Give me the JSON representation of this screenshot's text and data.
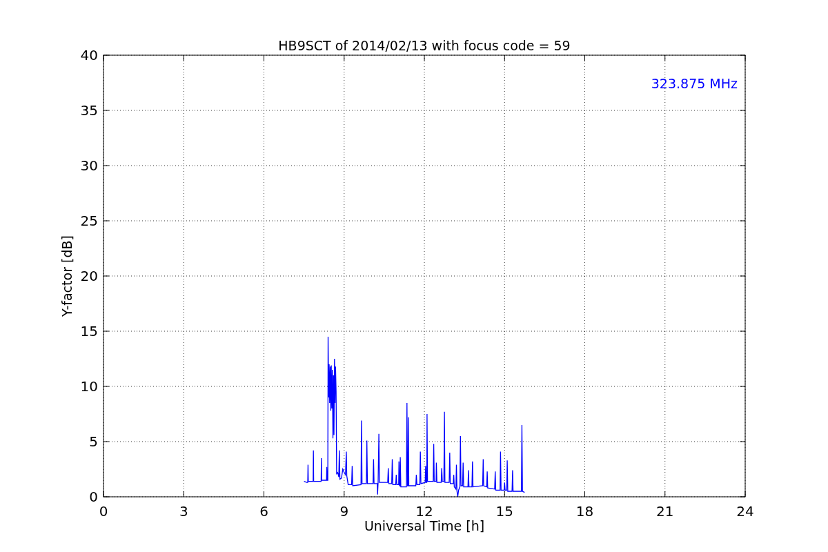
{
  "chart": {
    "chart_data": {
      "type": "line",
      "title": "HB9SCT of 2014/02/13 with focus code = 59",
      "xlabel": "Universal Time [h]",
      "ylabel": "Y-factor [dB]",
      "xlim": [
        0,
        24
      ],
      "ylim": [
        0,
        40
      ],
      "xticks": [
        0,
        3,
        6,
        9,
        12,
        15,
        18,
        21,
        24
      ],
      "yticks": [
        0,
        5,
        10,
        15,
        20,
        25,
        30,
        35,
        40
      ],
      "grid": true,
      "annotations": [
        {
          "text": "323.875 MHz"
        }
      ],
      "x": [
        7.5,
        7.6,
        7.64,
        7.65,
        7.66,
        7.84,
        7.85,
        7.86,
        8.14,
        8.15,
        8.16,
        8.34,
        8.35,
        8.37,
        8.39,
        8.4,
        8.42,
        8.44,
        8.46,
        8.48,
        8.5,
        8.52,
        8.54,
        8.56,
        8.58,
        8.6,
        8.62,
        8.64,
        8.66,
        8.68,
        8.7,
        8.72,
        8.76,
        8.8,
        8.82,
        8.84,
        8.9,
        8.95,
        9.0,
        9.05,
        9.08,
        9.1,
        9.15,
        9.28,
        9.3,
        9.32,
        9.63,
        9.65,
        9.67,
        9.83,
        9.85,
        9.87,
        10.08,
        10.1,
        10.12,
        10.24,
        10.25,
        10.27,
        10.3,
        10.32,
        10.63,
        10.65,
        10.67,
        10.78,
        10.8,
        10.82,
        10.93,
        10.95,
        10.97,
        11.04,
        11.05,
        11.07,
        11.09,
        11.1,
        11.12,
        11.33,
        11.35,
        11.37,
        11.39,
        11.4,
        11.42,
        11.68,
        11.7,
        11.72,
        11.83,
        11.85,
        11.87,
        12.03,
        12.05,
        12.07,
        12.09,
        12.1,
        12.12,
        12.33,
        12.35,
        12.37,
        12.44,
        12.45,
        12.47,
        12.63,
        12.65,
        12.67,
        12.73,
        12.75,
        12.77,
        12.93,
        12.95,
        12.97,
        13.08,
        13.1,
        13.12,
        13.18,
        13.2,
        13.22,
        13.25,
        13.28,
        13.33,
        13.35,
        13.37,
        13.43,
        13.45,
        13.47,
        13.63,
        13.65,
        13.67,
        13.78,
        13.8,
        13.82,
        14.18,
        14.2,
        14.22,
        14.33,
        14.35,
        14.37,
        14.63,
        14.65,
        14.67,
        14.83,
        14.85,
        14.87,
        14.98,
        15.0,
        15.02,
        15.08,
        15.1,
        15.12,
        15.28,
        15.3,
        15.32,
        15.63,
        15.65,
        15.67,
        15.75
      ],
      "series": [
        {
          "color": "#0000ff",
          "values": [
            1.4,
            1.3,
            1.3,
            2.9,
            1.4,
            1.4,
            4.2,
            1.4,
            1.4,
            3.5,
            1.5,
            1.5,
            2.7,
            1.5,
            1.5,
            14.5,
            9.0,
            12.0,
            8.5,
            11.8,
            7.8,
            11.9,
            8.0,
            11.5,
            5.3,
            11.0,
            5.6,
            12.5,
            8.5,
            11.8,
            9.5,
            2.1,
            2.2,
            1.8,
            4.2,
            1.6,
            1.7,
            2.5,
            2.2,
            2.0,
            4.1,
            1.9,
            1.1,
            1.1,
            2.8,
            1.0,
            1.1,
            6.9,
            1.2,
            1.2,
            5.1,
            1.2,
            1.2,
            3.4,
            1.2,
            1.2,
            0.2,
            1.3,
            5.7,
            1.3,
            1.3,
            2.6,
            1.2,
            1.2,
            3.4,
            1.1,
            1.1,
            2.0,
            1.1,
            1.1,
            3.2,
            1.0,
            1.0,
            3.6,
            0.9,
            0.9,
            8.5,
            1.0,
            1.0,
            7.2,
            1.0,
            1.0,
            2.0,
            1.1,
            1.1,
            4.1,
            1.2,
            1.3,
            2.8,
            1.3,
            1.3,
            7.5,
            1.4,
            1.4,
            4.8,
            1.4,
            1.4,
            3.1,
            1.3,
            1.3,
            2.6,
            1.4,
            1.4,
            7.7,
            1.3,
            1.3,
            4.0,
            1.2,
            1.2,
            2.0,
            0.9,
            0.7,
            2.9,
            0.5,
            0.0,
            0.6,
            0.9,
            5.5,
            1.0,
            1.0,
            3.1,
            0.9,
            0.9,
            2.4,
            0.9,
            0.9,
            3.2,
            0.9,
            1.0,
            3.4,
            1.0,
            0.9,
            2.3,
            0.8,
            0.7,
            2.3,
            0.6,
            0.6,
            4.1,
            0.6,
            0.6,
            1.3,
            0.6,
            0.6,
            3.3,
            0.5,
            0.5,
            2.4,
            0.5,
            0.5,
            6.5,
            0.5,
            0.4
          ]
        }
      ]
    }
  }
}
